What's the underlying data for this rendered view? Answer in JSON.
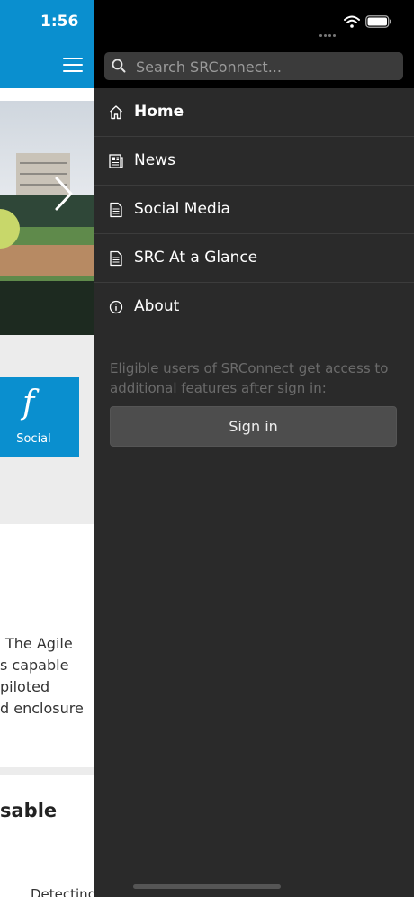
{
  "status": {
    "time": "1:56"
  },
  "background_app": {
    "social_label": "Social",
    "social_icon": "facebook-icon",
    "body_lines": [
      "The Agile",
      "s capable",
      "piloted",
      "d enclosure"
    ],
    "heading": "sable",
    "bottom_text": "Detecting"
  },
  "drawer": {
    "search": {
      "placeholder": "Search SRConnect..."
    },
    "menu": [
      {
        "label": "Home",
        "icon": "home-icon",
        "active": true
      },
      {
        "label": "News",
        "icon": "newspaper-icon",
        "active": false
      },
      {
        "label": "Social Media",
        "icon": "document-icon",
        "active": false
      },
      {
        "label": "SRC At a Glance",
        "icon": "document-icon",
        "active": false
      },
      {
        "label": "About",
        "icon": "info-icon",
        "active": false
      }
    ],
    "info_text": "Eligible users of SRConnect get access to additional features after sign in:",
    "sign_in_label": "Sign in"
  },
  "colors": {
    "brand_blue": "#0a8fcf",
    "drawer_bg": "#2a2a2a",
    "button_bg": "#4d4d4d"
  }
}
